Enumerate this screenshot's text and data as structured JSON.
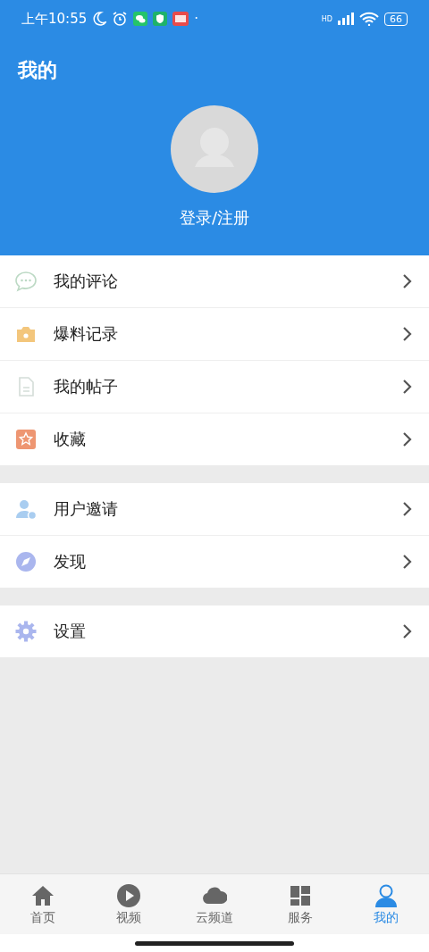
{
  "status_bar": {
    "time": "上午10:55",
    "dot": "·",
    "network": "HD",
    "battery": "66"
  },
  "header": {
    "title": "我的",
    "login": "登录/注册"
  },
  "menu_groups": [
    {
      "items": [
        {
          "label": "我的评论",
          "kind": "comment"
        },
        {
          "label": "爆料记录",
          "kind": "camera"
        },
        {
          "label": "我的帖子",
          "kind": "document"
        },
        {
          "label": "收藏",
          "kind": "star"
        }
      ]
    },
    {
      "items": [
        {
          "label": "用户邀请",
          "kind": "invite"
        },
        {
          "label": "发现",
          "kind": "compass"
        }
      ]
    },
    {
      "items": [
        {
          "label": "设置",
          "kind": "gear"
        }
      ]
    }
  ],
  "tab_bar": [
    {
      "label": "首页",
      "kind": "home",
      "selected": false
    },
    {
      "label": "视频",
      "kind": "play",
      "selected": false
    },
    {
      "label": "云频道",
      "kind": "cloud",
      "selected": false
    },
    {
      "label": "服务",
      "kind": "grid",
      "selected": false
    },
    {
      "label": "我的",
      "kind": "person",
      "selected": true
    }
  ]
}
